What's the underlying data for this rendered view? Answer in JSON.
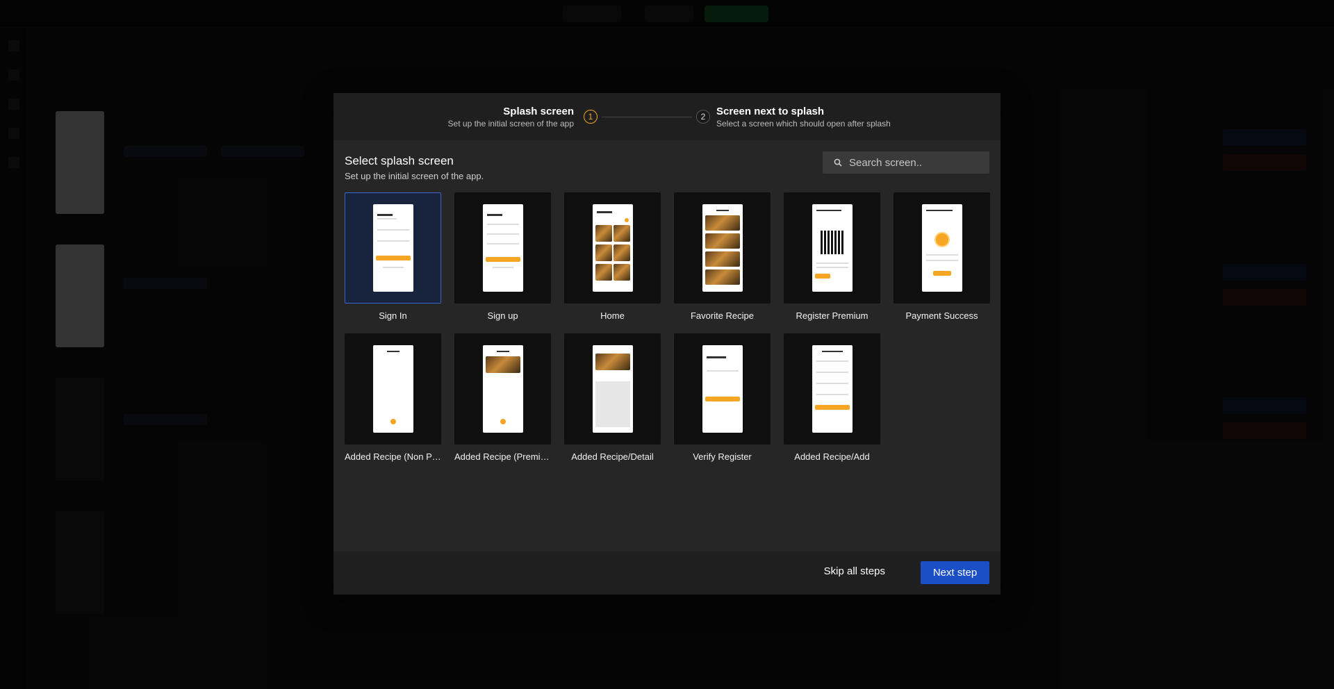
{
  "modal": {
    "steps": [
      {
        "number": "1",
        "title": "Splash screen",
        "subtitle": "Set up the initial screen of the app"
      },
      {
        "number": "2",
        "title": "Screen next to splash",
        "subtitle": "Select a screen which should open after splash"
      }
    ],
    "content": {
      "title": "Select splash screen",
      "subtitle": "Set up the initial screen of the app.",
      "search_placeholder": "Search screen.."
    },
    "screens": [
      {
        "label": "Sign In",
        "selected": true
      },
      {
        "label": "Sign up",
        "selected": false
      },
      {
        "label": "Home",
        "selected": false
      },
      {
        "label": "Favorite Recipe",
        "selected": false
      },
      {
        "label": "Register Premium",
        "selected": false
      },
      {
        "label": "Payment Success",
        "selected": false
      },
      {
        "label": "Added Recipe (Non Pr...",
        "selected": false
      },
      {
        "label": "Added Recipe (Premiu...",
        "selected": false
      },
      {
        "label": "Added Recipe/Detail",
        "selected": false
      },
      {
        "label": "Verify Register",
        "selected": false
      },
      {
        "label": "Added Recipe/Add",
        "selected": false
      }
    ],
    "footer": {
      "skip_label": "Skip all steps",
      "next_label": "Next step"
    }
  },
  "colors": {
    "accent": "#f5a623",
    "primary_button": "#1b4fc7",
    "selected_border": "#3b66d1"
  }
}
